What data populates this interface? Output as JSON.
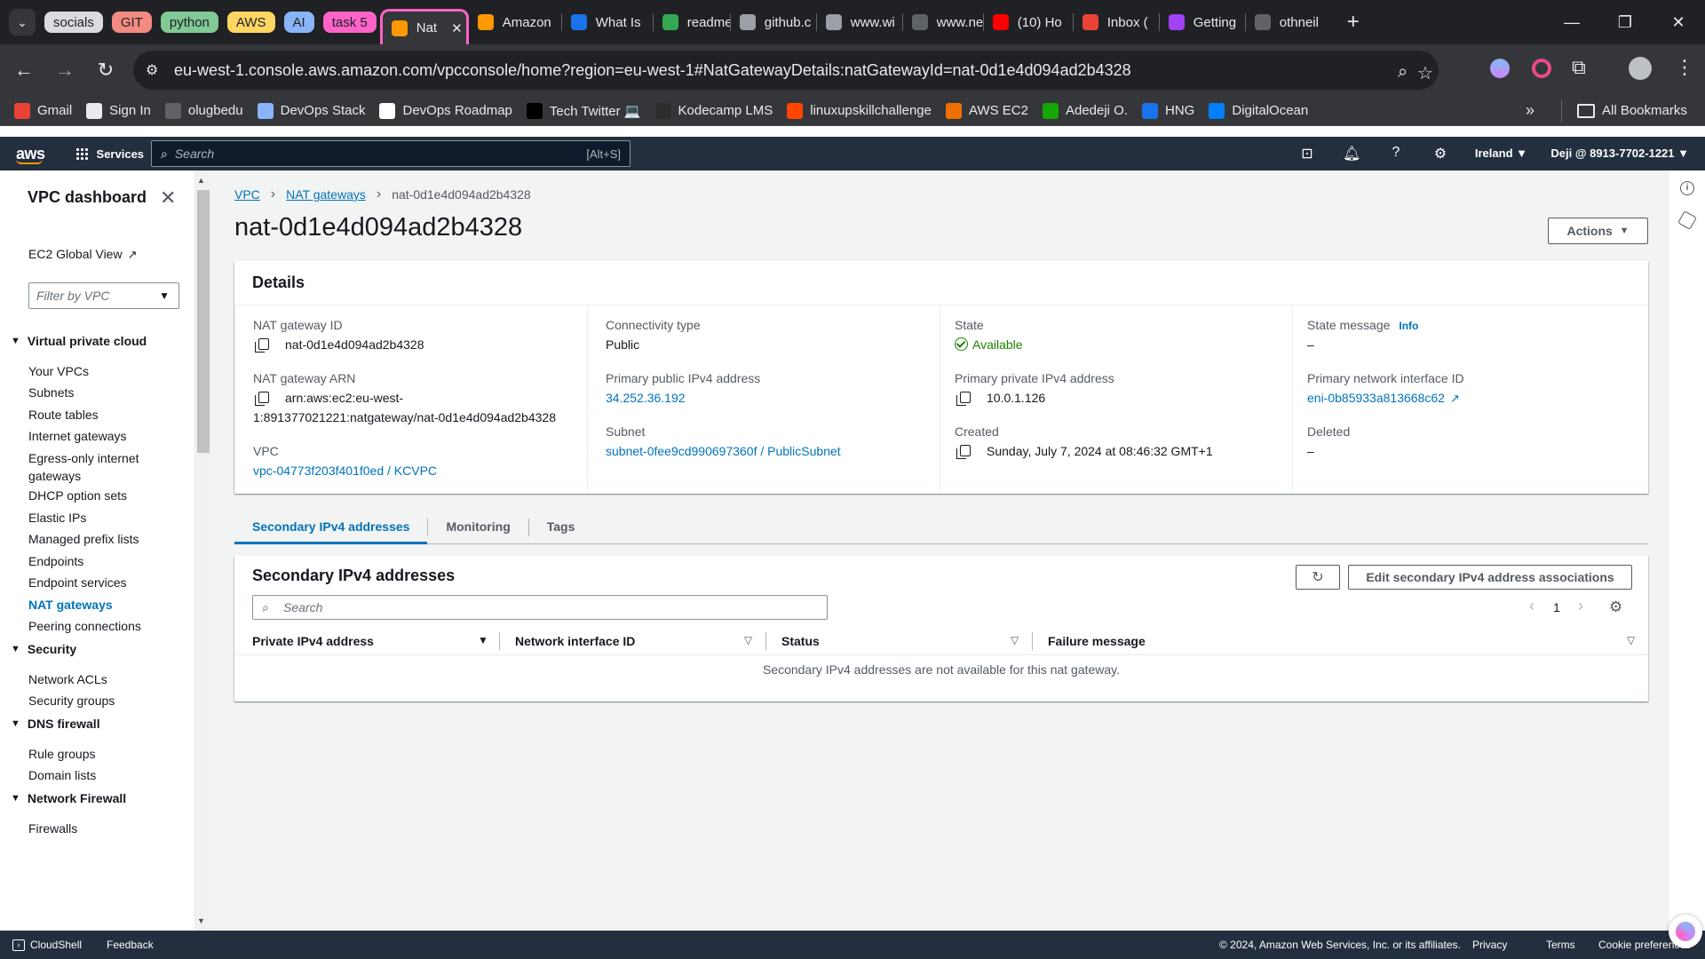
{
  "browser": {
    "tab_groups": [
      {
        "label": "socials",
        "color": "#dadce0"
      },
      {
        "label": "GIT",
        "color": "#f28b82"
      },
      {
        "label": "python",
        "color": "#81c995"
      },
      {
        "label": "AWS",
        "color": "#fdd663"
      },
      {
        "label": "AI",
        "color": "#8ab4f8"
      },
      {
        "label": "task 5",
        "color": "#ff63c8"
      }
    ],
    "tabs": [
      {
        "label": "Nat",
        "active": true,
        "icon_color": "#ff9900"
      },
      {
        "label": "Amazon",
        "icon_color": "#ff9900"
      },
      {
        "label": "What Is",
        "icon_color": "#1a73e8"
      },
      {
        "label": "readme",
        "icon_color": "#34a853"
      },
      {
        "label": "github.c",
        "icon_color": "#9aa0a6"
      },
      {
        "label": "www.wi",
        "icon_color": "#9aa0a6"
      },
      {
        "label": "www.ne",
        "icon_color": "#5f6368"
      },
      {
        "label": "(10) Ho",
        "icon_color": "#ff0000"
      },
      {
        "label": "Inbox (",
        "icon_color": "#ea4335"
      },
      {
        "label": "Getting",
        "icon_color": "#a142f4"
      },
      {
        "label": "othneil",
        "icon_color": "#5f6368"
      }
    ],
    "url": "eu-west-1.console.aws.amazon.com/vpcconsole/home?region=eu-west-1#NatGatewayDetails:natGatewayId=nat-0d1e4d094ad2b4328",
    "bookmarks": [
      {
        "label": "Gmail",
        "icon_color": "#ea4335"
      },
      {
        "label": "Sign In",
        "icon_color": "#e8eaed"
      },
      {
        "label": "olugbedu",
        "icon_color": "#5f6368"
      },
      {
        "label": "DevOps Stack",
        "icon_color": "#8ab4f8"
      },
      {
        "label": "DevOps Roadmap",
        "icon_color": "#ffffff"
      },
      {
        "label": "Tech Twitter 💻",
        "icon_color": "#000000"
      },
      {
        "label": "Kodecamp LMS",
        "icon_color": "#2d2d2d"
      },
      {
        "label": "linuxupskillchallenge",
        "icon_color": "#ff4500"
      },
      {
        "label": "AWS EC2",
        "icon_color": "#ed7100"
      },
      {
        "label": "Adedeji O.",
        "icon_color": "#14a800"
      },
      {
        "label": "HNG",
        "icon_color": "#1a73e8"
      },
      {
        "label": "DigitalOcean",
        "icon_color": "#0080ff"
      }
    ],
    "all_bookmarks": "All Bookmarks"
  },
  "aws_header": {
    "logo": "aws",
    "services": "Services",
    "search_placeholder": "Search",
    "search_shortcut": "[Alt+S]",
    "region": "Ireland ▼",
    "account": "Deji @ 8913-7702-1221 ▼"
  },
  "sidebar": {
    "title": "VPC dashboard",
    "ec2_global_view": "EC2 Global View",
    "filter_placeholder": "Filter by VPC",
    "sections": [
      {
        "title": "Virtual private cloud",
        "items": [
          "Your VPCs",
          "Subnets",
          "Route tables",
          "Internet gateways",
          "Egress-only internet gateways",
          "DHCP option sets",
          "Elastic IPs",
          "Managed prefix lists",
          "Endpoints",
          "Endpoint services",
          "NAT gateways",
          "Peering connections"
        ]
      },
      {
        "title": "Security",
        "items": [
          "Network ACLs",
          "Security groups"
        ]
      },
      {
        "title": "DNS firewall",
        "items": [
          "Rule groups",
          "Domain lists"
        ]
      },
      {
        "title": "Network Firewall",
        "items": [
          "Firewalls"
        ]
      }
    ],
    "egress_line1": "Egress-only internet",
    "egress_line2": "gateways",
    "active_item": "NAT gateways"
  },
  "breadcrumb": {
    "items": [
      "VPC",
      "NAT gateways"
    ],
    "current": "nat-0d1e4d094ad2b4328"
  },
  "page_title": "nat-0d1e4d094ad2b4328",
  "actions_label": "Actions",
  "details": {
    "heading": "Details",
    "nat_gateway_id_label": "NAT gateway ID",
    "nat_gateway_id": "nat-0d1e4d094ad2b4328",
    "arn_label": "NAT gateway ARN",
    "arn_line1": "arn:aws:ec2:eu-west-",
    "arn_line2": "1:891377021221:natgateway/nat-0d1e4d094ad2b4328",
    "vpc_label": "VPC",
    "vpc": "vpc-04773f203f401f0ed / KCVPC",
    "connectivity_label": "Connectivity type",
    "connectivity": "Public",
    "public_ip_label": "Primary public IPv4 address",
    "public_ip": "34.252.36.192",
    "subnet_label": "Subnet",
    "subnet": "subnet-0fee9cd990697360f / PublicSubnet",
    "state_label": "State",
    "state": "Available",
    "private_ip_label": "Primary private IPv4 address",
    "private_ip": "10.0.1.126",
    "created_label": "Created",
    "created": "Sunday, July 7, 2024 at 08:46:32 GMT+1",
    "state_message_label": "State message",
    "info": "Info",
    "state_message": "–",
    "eni_label": "Primary network interface ID",
    "eni": "eni-0b85933a813668c62",
    "deleted_label": "Deleted",
    "deleted": "–"
  },
  "tabs": [
    "Secondary IPv4 addresses",
    "Monitoring",
    "Tags"
  ],
  "secondary": {
    "heading": "Secondary IPv4 addresses",
    "edit_button": "Edit secondary IPv4 address associations",
    "search_placeholder": "Search",
    "page": "1",
    "columns": [
      "Private IPv4 address",
      "Network interface ID",
      "Status",
      "Failure message"
    ],
    "empty_message": "Secondary IPv4 addresses are not available for this nat gateway."
  },
  "footer": {
    "cloudshell": "CloudShell",
    "feedback": "Feedback",
    "copyright": "© 2024, Amazon Web Services, Inc. or its affiliates.",
    "privacy": "Privacy",
    "terms": "Terms",
    "cookie": "Cookie preferences"
  }
}
